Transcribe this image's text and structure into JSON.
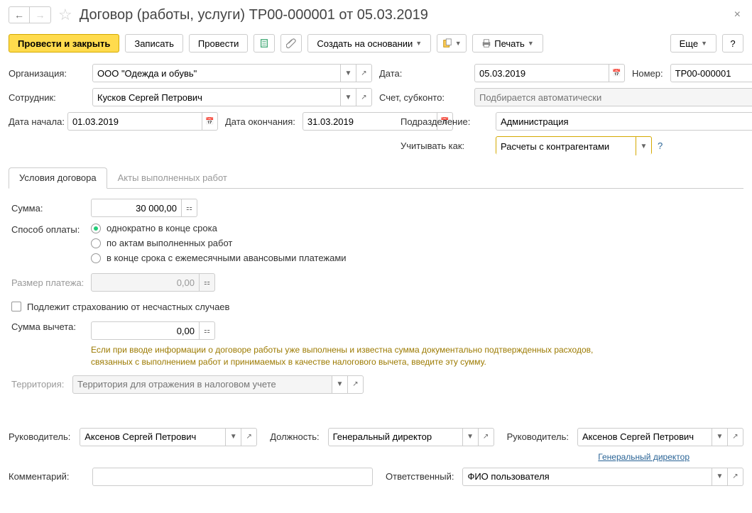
{
  "header": {
    "title": "Договор (работы, услуги) ТР00-000001 от 05.03.2019"
  },
  "toolbar": {
    "post_close": "Провести и закрыть",
    "save": "Записать",
    "post": "Провести",
    "create_based": "Создать на основании",
    "print": "Печать",
    "more": "Еще",
    "help": "?"
  },
  "fields": {
    "org_label": "Организация:",
    "org_value": "ООО \"Одежда и обувь\"",
    "date_label": "Дата:",
    "date_value": "05.03.2019",
    "number_label": "Номер:",
    "number_value": "ТР00-000001",
    "employee_label": "Сотрудник:",
    "employee_value": "Кусков Сергей Петрович",
    "account_label": "Счет, субконто:",
    "account_placeholder": "Подбирается автоматически",
    "start_label": "Дата начала:",
    "start_value": "01.03.2019",
    "end_label": "Дата окончания:",
    "end_value": "31.03.2019",
    "division_label": "Подразделение:",
    "division_value": "Администрация",
    "account_as_label": "Учитывать как:",
    "account_as_value": "Расчеты с контрагентами"
  },
  "tabs": {
    "tab1": "Условия договора",
    "tab2": "Акты выполненных работ"
  },
  "contract": {
    "sum_label": "Сумма:",
    "sum_value": "30 000,00",
    "pay_method_label": "Способ оплаты:",
    "pay_opt1": "однократно в конце срока",
    "pay_opt2": "по актам выполненных работ",
    "pay_opt3": "в конце срока с ежемесячными авансовыми платежами",
    "payment_size_label": "Размер платежа:",
    "payment_size_value": "0,00",
    "insurance_label": "Подлежит страхованию от несчастных случаев",
    "deduction_label": "Сумма вычета:",
    "deduction_value": "0,00",
    "hint": "Если при вводе информации о договоре работы уже выполнены и известна сумма документально подтвержденных расходов, связанных с выполнением работ и принимаемых в качестве налогового вычета, введите эту сумму.",
    "territory_label": "Территория:",
    "territory_placeholder": "Территория для отражения в налоговом учете"
  },
  "footer": {
    "manager_label": "Руководитель:",
    "manager_value": "Аксенов Сергей Петрович",
    "position_label": "Должность:",
    "position_value": "Генеральный директор",
    "manager2_label": "Руководитель:",
    "manager2_value": "Аксенов Сергей Петрович",
    "position_link": "Генеральный директор",
    "comment_label": "Комментарий:",
    "responsible_label": "Ответственный:",
    "responsible_value": "ФИО пользователя"
  }
}
